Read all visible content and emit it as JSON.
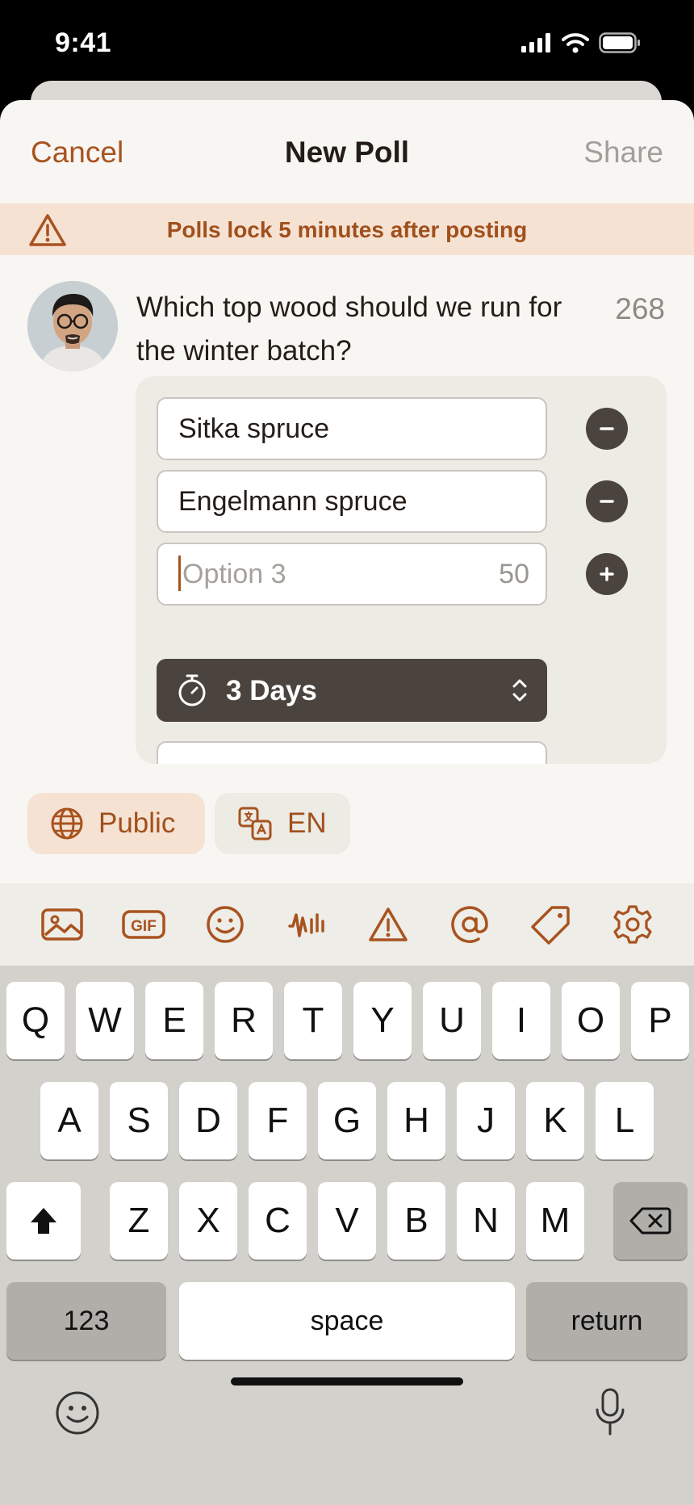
{
  "status_bar": {
    "time": "9:41"
  },
  "nav": {
    "cancel": "Cancel",
    "title": "New Poll",
    "share": "Share"
  },
  "banner": {
    "text": "Polls lock 5 minutes after posting"
  },
  "composer": {
    "question": "Which top wood should we run for the winter batch?",
    "char_counter": "268"
  },
  "poll": {
    "options": [
      {
        "value": "Sitka spruce"
      },
      {
        "value": "Engelmann spruce"
      }
    ],
    "new_option": {
      "placeholder": "Option 3",
      "char_counter": "50"
    },
    "duration": "3 Days"
  },
  "chips": {
    "visibility": "Public",
    "language": "EN"
  },
  "toolbar": {
    "icons": [
      "image-icon",
      "gif-icon",
      "emoji-icon",
      "audio-waveform-icon",
      "content-warning-icon",
      "mention-icon",
      "tag-icon",
      "settings-icon"
    ]
  },
  "keyboard": {
    "row1": [
      "Q",
      "W",
      "E",
      "R",
      "T",
      "Y",
      "U",
      "I",
      "O",
      "P"
    ],
    "row2": [
      "A",
      "S",
      "D",
      "F",
      "G",
      "H",
      "J",
      "K",
      "L"
    ],
    "row3": [
      "Z",
      "X",
      "C",
      "V",
      "B",
      "N",
      "M"
    ],
    "numbers": "123",
    "space": "space",
    "return": "return"
  },
  "colors": {
    "accent": "#a8531f",
    "banner_bg": "#f6e2d3",
    "dark_control": "#4b443e"
  }
}
